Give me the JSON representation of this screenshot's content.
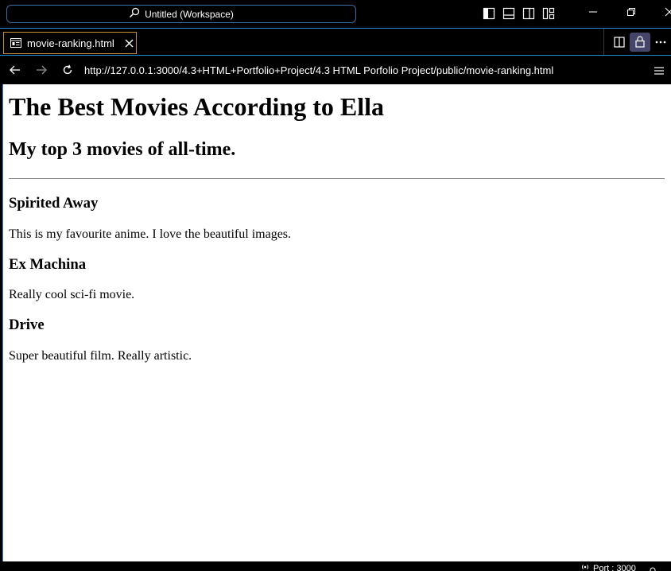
{
  "titlebar": {
    "workspace_label": "Untitled (Workspace)",
    "icons": [
      "search-icon",
      "toggle-primary-sidebar-icon",
      "toggle-panel-icon",
      "toggle-secondary-sidebar-icon",
      "customize-layout-icon",
      "minimize-icon",
      "restore-icon",
      "close-icon"
    ]
  },
  "tab": {
    "label": "movie-ranking.html",
    "icon": "preview-page-icon"
  },
  "tab_actions": [
    "split-editor-icon",
    "lock-icon",
    "more-actions-icon"
  ],
  "addressbar": {
    "url": "http://127.0.0.1:3000/4.3+HTML+Portfolio+Project/4.3 HTML Porfolio Project/public/movie-ranking.html"
  },
  "page": {
    "title": "The Best Movies According to Ella",
    "subtitle": "My top 3 movies of all-time.",
    "movies": [
      {
        "name": "Spirited Away",
        "comment": "This is my favourite anime. I love the beautiful images."
      },
      {
        "name": "Ex Machina",
        "comment": "Really cool sci-fi movie."
      },
      {
        "name": "Drive",
        "comment": "Super beautiful film. Really artistic."
      }
    ]
  },
  "statusbar": {
    "port_label": "Port : 3000"
  },
  "colors": {
    "accent_blue": "#1f8ad2",
    "tab_border": "#c8903a",
    "command_center_border": "#3b6fa7"
  }
}
